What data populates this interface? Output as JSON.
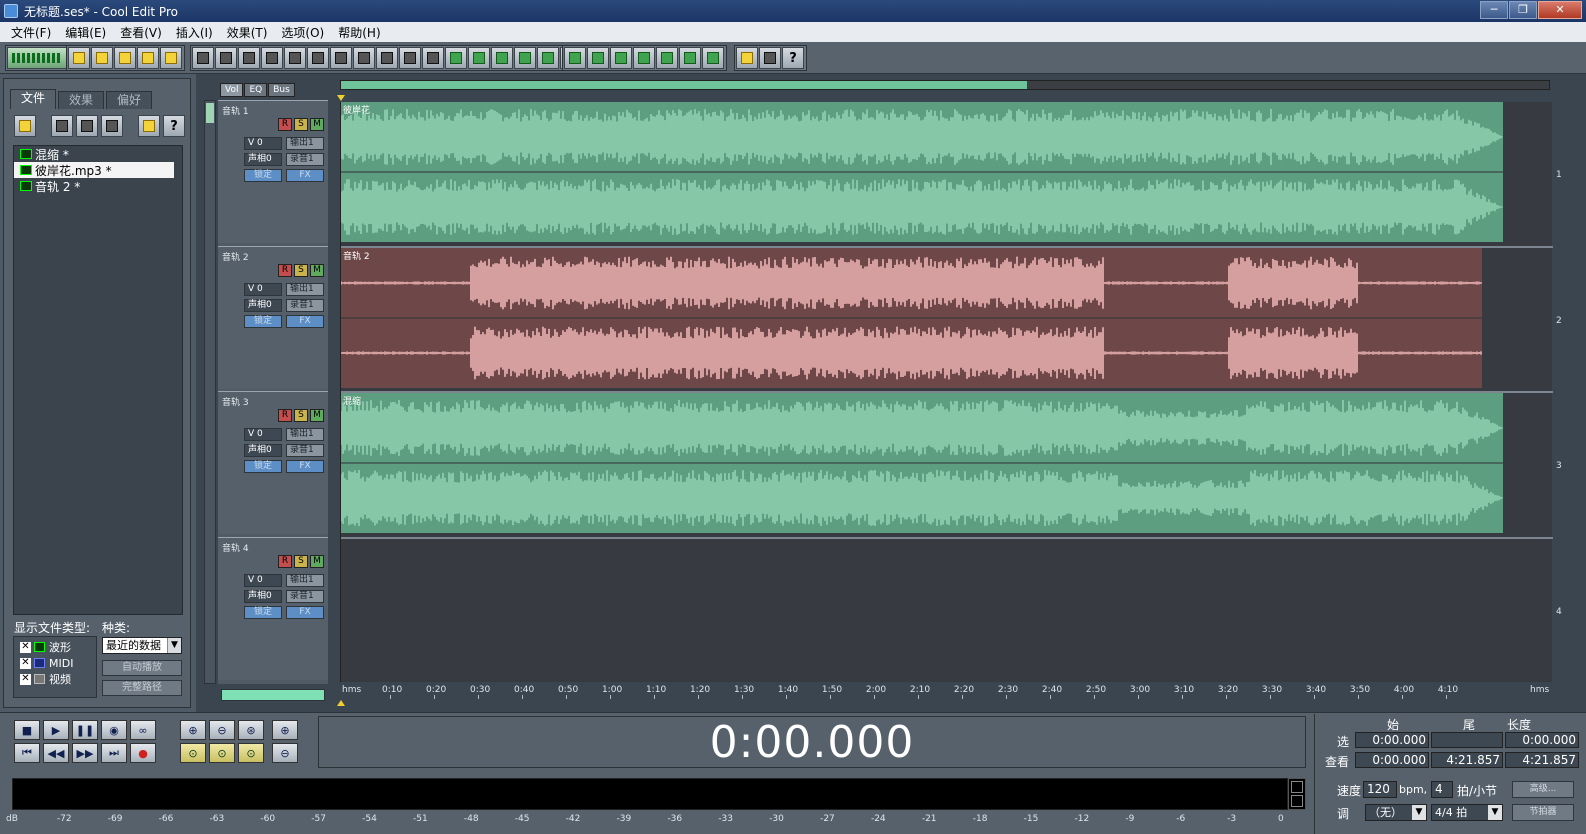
{
  "window": {
    "title": "无标题.ses* - Cool Edit Pro",
    "minimize": "─",
    "maximize": "❐",
    "close": "✕"
  },
  "menu": [
    "文件(F)",
    "编辑(E)",
    "查看(V)",
    "插入(I)",
    "效果(T)",
    "选项(O)",
    "帮助(H)"
  ],
  "organizer": {
    "tabs": [
      "文件",
      "效果",
      "偏好"
    ],
    "active_tab": "文件",
    "files": [
      {
        "name": "混缩 *",
        "selected": false
      },
      {
        "name": "彼岸花.mp3 *",
        "selected": true
      },
      {
        "name": "音轨  2 *",
        "selected": false
      }
    ],
    "file_type_label": "显示文件类型:",
    "kind_label": "种类:",
    "file_types": [
      {
        "label": "波形",
        "checked": true
      },
      {
        "label": "MIDI",
        "checked": true
      },
      {
        "label": "视频",
        "checked": true
      }
    ],
    "kind_selected": "最近的数据",
    "autoplay_button": "自动播放",
    "fullpath_button": "完整路径"
  },
  "track_view_tabs": [
    "Vol",
    "EQ",
    "Bus"
  ],
  "tracks": [
    {
      "header": "音轨  1",
      "volume": "V 0",
      "pan": "声相0",
      "out": "输出1",
      "rec": "录音1",
      "lock": "锁定",
      "fx": "FX",
      "clip_label": "彼岸花",
      "clip_color": "#5e9e80",
      "number": "1"
    },
    {
      "header": "音轨  2",
      "volume": "V 0",
      "pan": "声相0",
      "out": "输出1",
      "rec": "录音1",
      "lock": "锁定",
      "fx": "FX",
      "clip_label": "音轨  2",
      "clip_color": "#6e4848",
      "number": "2"
    },
    {
      "header": "音轨  3",
      "volume": "V 0",
      "pan": "声相0",
      "out": "输出1",
      "rec": "录音1",
      "lock": "锁定",
      "fx": "FX",
      "clip_label": "混缩",
      "clip_color": "#5e9e80",
      "number": "3"
    },
    {
      "header": "音轨  4",
      "volume": "V 0",
      "pan": "声相0",
      "out": "输出1",
      "rec": "录音1",
      "lock": "锁定",
      "fx": "FX",
      "clip_label": "",
      "clip_color": "",
      "number": "4"
    }
  ],
  "rsm_labels": [
    "R",
    "S",
    "M"
  ],
  "ruler": {
    "unit_left": "hms",
    "unit_right": "hms",
    "ticks": [
      "0:10",
      "0:20",
      "0:30",
      "0:40",
      "0:50",
      "1:00",
      "1:10",
      "1:20",
      "1:30",
      "1:40",
      "1:50",
      "2:00",
      "2:10",
      "2:20",
      "2:30",
      "2:40",
      "2:50",
      "3:00",
      "3:10",
      "3:20",
      "3:30",
      "3:40",
      "3:50",
      "4:00",
      "4:10"
    ]
  },
  "transport": {
    "time_display": "0:00.000"
  },
  "selection": {
    "col_begin": "始",
    "col_end": "尾",
    "col_length": "长度",
    "row_select": "选",
    "row_view": "查看",
    "select_begin": "0:00.000",
    "select_end": "",
    "select_length": "0:00.000",
    "view_begin": "0:00.000",
    "view_end": "4:21.857",
    "view_length": "4:21.857"
  },
  "level_meter": {
    "labels": [
      "dB",
      "-72",
      "-69",
      "-66",
      "-63",
      "-60",
      "-57",
      "-54",
      "-51",
      "-48",
      "-45",
      "-42",
      "-39",
      "-36",
      "-33",
      "-30",
      "-27",
      "-24",
      "-21",
      "-18",
      "-15",
      "-12",
      "-9",
      "-6",
      "-3",
      "0"
    ]
  },
  "tempo": {
    "tempo_label": "速度",
    "tempo_value": "120",
    "bpm_label": "bpm,",
    "beats_value": "4",
    "beats_label": "拍/小节",
    "key_label": "调",
    "key_value": "（无）",
    "time_sig": "4/4 拍",
    "advanced_button": "高级...",
    "metronome_button": "节拍器"
  },
  "colors": {
    "green_wave": "#5e9e80",
    "red_wave": "#6e4848",
    "clip_bg_empty": "#373b41",
    "panel": "#56616c"
  }
}
